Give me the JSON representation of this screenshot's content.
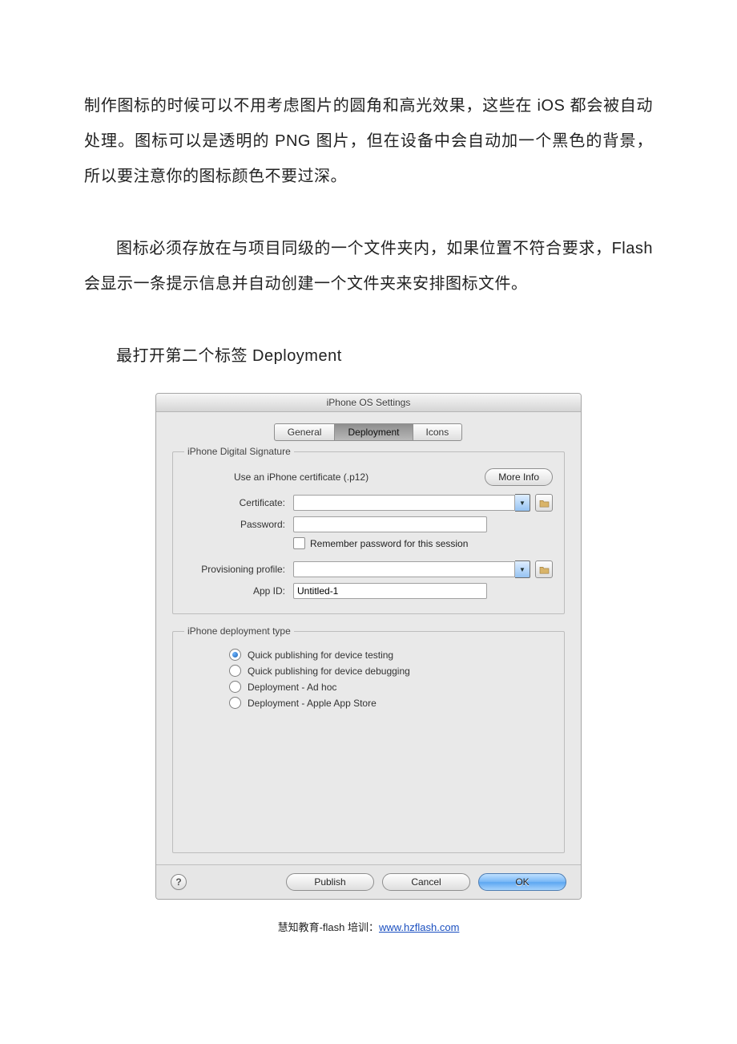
{
  "paragraph1": "制作图标的时候可以不用考虑图片的圆角和高光效果，这些在 iOS 都会被自动处理。图标可以是透明的 PNG 图片，但在设备中会自动加一个黑色的背景，所以要注意你的图标颜色不要过深。",
  "paragraph2": "图标必须存放在与项目同级的一个文件夹内，如果位置不符合要求，Flash 会显示一条提示信息并自动创建一个文件夹来安排图标文件。",
  "paragraph3": "最打开第二个标签 Deployment",
  "dialog": {
    "title": "iPhone OS Settings",
    "tabs": {
      "general": "General",
      "deployment": "Deployment",
      "icons": "Icons"
    },
    "signature": {
      "legend": "iPhone Digital Signature",
      "hint": "Use an iPhone certificate (.p12)",
      "moreInfo": "More Info",
      "certificateLabel": "Certificate:",
      "certificateValue": "",
      "passwordLabel": "Password:",
      "passwordValue": "",
      "rememberLabel": "Remember password for this session",
      "provisioningLabel": "Provisioning profile:",
      "provisioningValue": "",
      "appIdLabel": "App ID:",
      "appIdValue": "Untitled-1"
    },
    "deployType": {
      "legend": "iPhone deployment type",
      "options": [
        "Quick publishing for device testing",
        "Quick publishing for device debugging",
        "Deployment - Ad hoc",
        "Deployment - Apple App Store"
      ]
    },
    "buttons": {
      "publish": "Publish",
      "cancel": "Cancel",
      "ok": "OK",
      "help": "?"
    }
  },
  "footer": {
    "prefix": "慧知教育-flash 培训：",
    "link": "www.hzflash.com"
  }
}
